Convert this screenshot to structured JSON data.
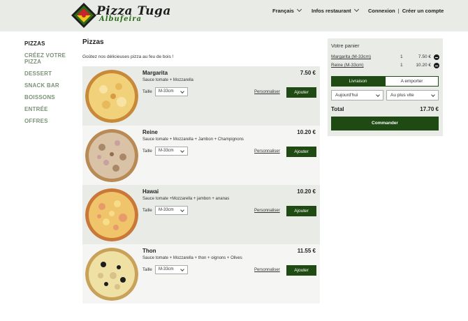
{
  "brand": {
    "name": "Pizza Tuga",
    "location": "Albufeira",
    "colors": {
      "green": "#2b6b18",
      "dark_green": "#1f4a14",
      "red": "#c8242b",
      "yellow": "#f2c21a"
    }
  },
  "header": {
    "language": "Français",
    "info": "Infos restaurant",
    "login": "Connexion",
    "separator": "|",
    "signup": "Créer un compte"
  },
  "sidebar": {
    "items": [
      {
        "label": "PIZZAS",
        "active": true
      },
      {
        "label": "CRÉEZ VOTRE PIZZA",
        "active": false
      },
      {
        "label": "DESSERT",
        "active": false
      },
      {
        "label": "SNACK BAR",
        "active": false
      },
      {
        "label": "BOISSONS",
        "active": false
      },
      {
        "label": "ENTRÉE",
        "active": false
      },
      {
        "label": "OFFRES",
        "active": false
      }
    ]
  },
  "main": {
    "title": "Pizzas",
    "intro": "Goûtez nos délicieuses pizza au feu de bois !",
    "size_label": "Taille",
    "customize_label": "Personnaliser",
    "add_label": "Ajouter",
    "pizzas": [
      {
        "name": "Margarita",
        "price": "7.50 €",
        "description": "Sauce tomate + Mozzarella",
        "size": "M-33cm"
      },
      {
        "name": "Reine",
        "price": "10.20 €",
        "description": "Sauce tomate + Mozzarella + Jambon + Champignons",
        "size": "M-33cm"
      },
      {
        "name": "Hawai",
        "price": "10.20 €",
        "description": "Sauce tomate +Mozzarella + jambon + ananas",
        "size": "M-33cm"
      },
      {
        "name": "Thon",
        "price": "11.55 €",
        "description": "Sauce tomate + Mozzarella + thon + oignons + Olives",
        "size": "M-33cm"
      }
    ]
  },
  "cart": {
    "title": "Votre panier",
    "items": [
      {
        "name": "Margarita (M-33cm)",
        "qty": "1",
        "price": "7.50 €"
      },
      {
        "name": "Reine (M-33cm)",
        "qty": "1",
        "price": "10.20 €"
      }
    ],
    "tab_delivery": "Livraison",
    "tab_takeaway": "A emporter",
    "day_select": "Aujourd'hui",
    "time_select": "Au plus vite",
    "total_label": "Total",
    "total_value": "17.70 €",
    "order_label": "Commander"
  }
}
